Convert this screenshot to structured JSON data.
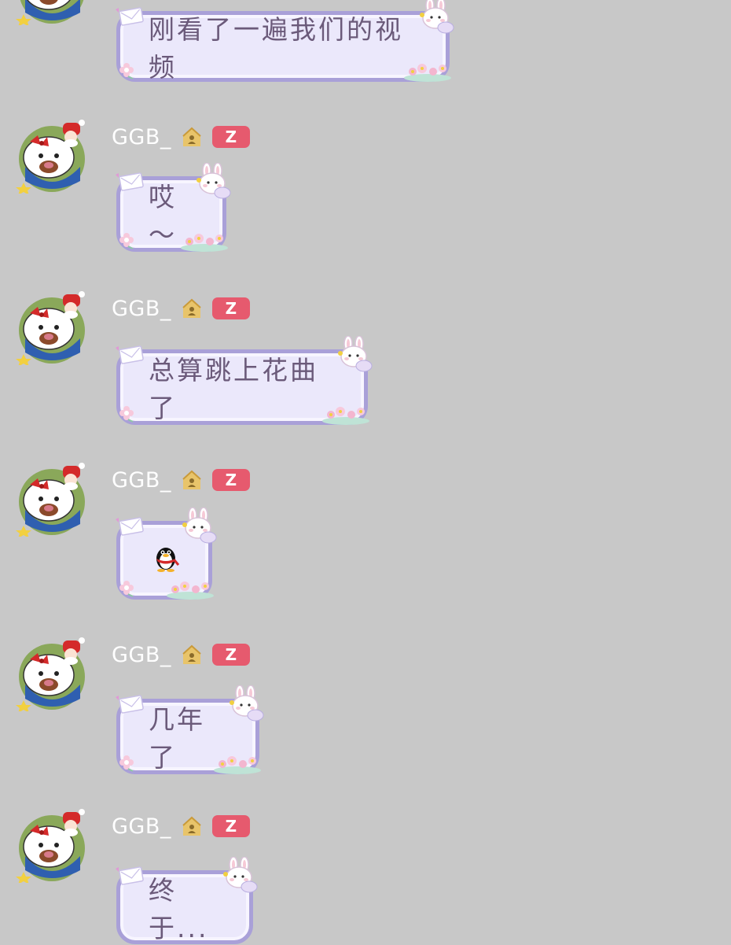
{
  "messages": [
    {
      "sender": "",
      "text": "刚看了一遍我们的视频",
      "badge": ""
    },
    {
      "sender": "GGB_",
      "text": "哎～",
      "badge": "Z"
    },
    {
      "sender": "GGB_",
      "text": "总算跳上花曲了",
      "badge": "Z"
    },
    {
      "sender": "GGB_",
      "text": "",
      "badge": "Z",
      "emoji": "qq-penguin-icon"
    },
    {
      "sender": "GGB_",
      "text": "几年了",
      "badge": "Z"
    },
    {
      "sender": "GGB_",
      "text": "终于...",
      "badge": "Z"
    }
  ],
  "colors": {
    "background": "#c8c8c8",
    "bubble_fill": "#ebe8fb",
    "bubble_border": "#a9a0d8",
    "bubble_text": "#6b5a7a",
    "badge": "#e65a6e",
    "name": "#ffffff"
  },
  "icons": {
    "avatar": "hello-kitty-avatar-icon",
    "house": "house-icon",
    "emoji": "qq-penguin-icon"
  }
}
